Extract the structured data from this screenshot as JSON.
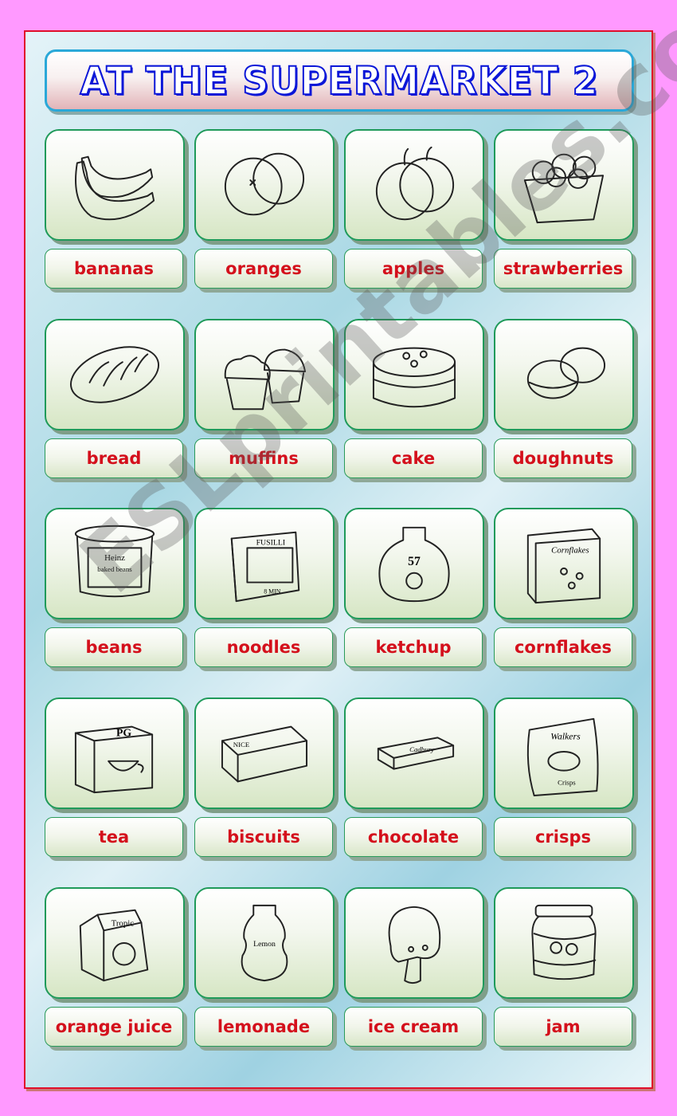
{
  "title": "AT THE SUPERMARKET 2",
  "watermark": "ESLprintables.com",
  "colors": {
    "page_background": "#ff99ff",
    "frame_border": "#e0102a",
    "title_text": "#0b17d8",
    "label_text": "#d4101c",
    "card_border": "#1f9a5a"
  },
  "items": [
    {
      "label": "bananas",
      "icon": "bananas-icon"
    },
    {
      "label": "oranges",
      "icon": "oranges-icon"
    },
    {
      "label": "apples",
      "icon": "apples-icon"
    },
    {
      "label": "strawberries",
      "icon": "strawberries-icon"
    },
    {
      "label": "bread",
      "icon": "bread-icon"
    },
    {
      "label": "muffins",
      "icon": "muffins-icon"
    },
    {
      "label": "cake",
      "icon": "cake-icon"
    },
    {
      "label": "doughnuts",
      "icon": "doughnuts-icon"
    },
    {
      "label": "beans",
      "icon": "beans-can-icon",
      "image_text": [
        "Heinz",
        "baked beans"
      ]
    },
    {
      "label": "noodles",
      "icon": "noodles-box-icon",
      "image_text": [
        "FUSILLI",
        "8 MIN"
      ]
    },
    {
      "label": "ketchup",
      "icon": "ketchup-bottle-icon",
      "image_text": [
        "57"
      ]
    },
    {
      "label": "cornflakes",
      "icon": "cornflakes-box-icon",
      "image_text": [
        "Cornflakes"
      ]
    },
    {
      "label": "tea",
      "icon": "tea-box-icon",
      "image_text": [
        "PG"
      ]
    },
    {
      "label": "biscuits",
      "icon": "biscuits-pack-icon",
      "image_text": [
        "NICE"
      ]
    },
    {
      "label": "chocolate",
      "icon": "chocolate-bar-icon",
      "image_text": [
        "Cadbury"
      ]
    },
    {
      "label": "crisps",
      "icon": "crisps-bag-icon",
      "image_text": [
        "Walkers",
        "Crisps"
      ]
    },
    {
      "label": "orange juice",
      "icon": "juice-carton-icon",
      "image_text": [
        "Tropic"
      ]
    },
    {
      "label": "lemonade",
      "icon": "lemonade-bottle-icon",
      "image_text": [
        "Lemon"
      ]
    },
    {
      "label": "ice cream",
      "icon": "ice-cream-icon"
    },
    {
      "label": "jam",
      "icon": "jam-jar-icon"
    }
  ]
}
